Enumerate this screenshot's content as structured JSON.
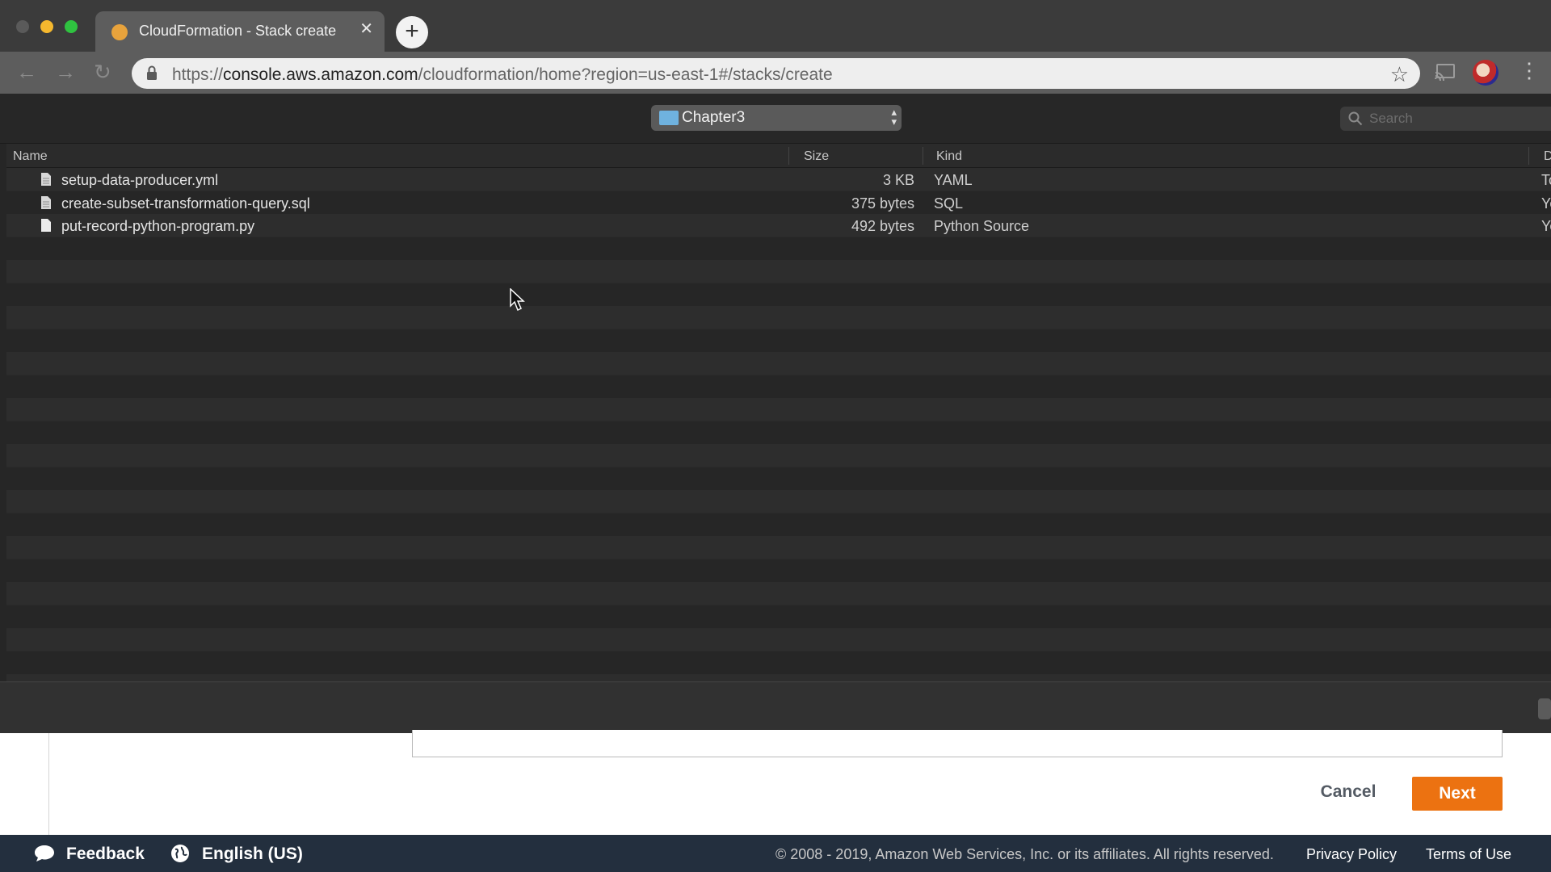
{
  "browser": {
    "tab_title": "CloudFormation - Stack create",
    "url_scheme": "https://",
    "url_host": "console.aws.amazon.com",
    "url_path": "/cloudformation/home?region=us-east-1#/stacks/create"
  },
  "dialog": {
    "folder": "Chapter3",
    "search_placeholder": "Search",
    "columns": {
      "name": "Name",
      "size": "Size",
      "kind": "Kind",
      "date": "D"
    },
    "files": [
      {
        "name": "setup-data-producer.yml",
        "size": "3 KB",
        "kind": "YAML",
        "date": "To"
      },
      {
        "name": "create-subset-transformation-query.sql",
        "size": "375 bytes",
        "kind": "SQL",
        "date": "Ye"
      },
      {
        "name": "put-record-python-program.py",
        "size": "492 bytes",
        "kind": "Python Source",
        "date": "Ye"
      }
    ]
  },
  "page": {
    "cancel_label": "Cancel",
    "next_label": "Next",
    "accent_color": "#ec7211"
  },
  "footer": {
    "feedback": "Feedback",
    "language": "English (US)",
    "copyright": "© 2008 - 2019, Amazon Web Services, Inc. or its affiliates. All rights reserved.",
    "privacy": "Privacy Policy",
    "terms": "Terms of Use"
  }
}
